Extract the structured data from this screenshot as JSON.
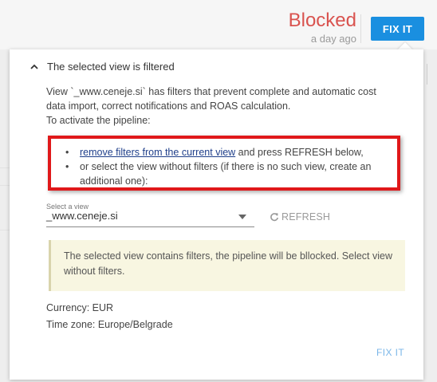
{
  "header": {
    "status": "Blocked",
    "time": "a day ago",
    "fix_button": "FIX IT"
  },
  "popover": {
    "title": "The selected view is filtered",
    "message_lines": [
      "View `_www.ceneje.si` has filters that prevent complete and automatic cost",
      "data import, correct notifications and ROAS calculation.",
      "To activate the pipeline:"
    ],
    "steps": {
      "step1_link": "remove filters from the current view",
      "step1_rest": " and press REFRESH below,",
      "step2_line1": "or select the view without filters (if there is no such view, create an",
      "step2_line2": "additional one):"
    },
    "select": {
      "label": "Select a view",
      "value": "_www.ceneje.si"
    },
    "refresh_label": "REFRESH",
    "warning_lines": [
      "The selected view contains filters, the pipeline will be bllocked. Select view",
      "without filters."
    ],
    "currency": "Currency: EUR",
    "timezone": "Time zone: Europe/Belgrade",
    "fix_button": "FIX IT"
  },
  "colors": {
    "status": "#d9534f",
    "primary_button": "#1a8fe0",
    "highlight_border": "#e0181a",
    "warning_bg": "#f8f6e1",
    "link": "#1f3f8a"
  },
  "icons": {
    "collapse": "chevron-up-icon",
    "dropdown": "caret-down-icon",
    "refresh": "refresh-icon"
  }
}
